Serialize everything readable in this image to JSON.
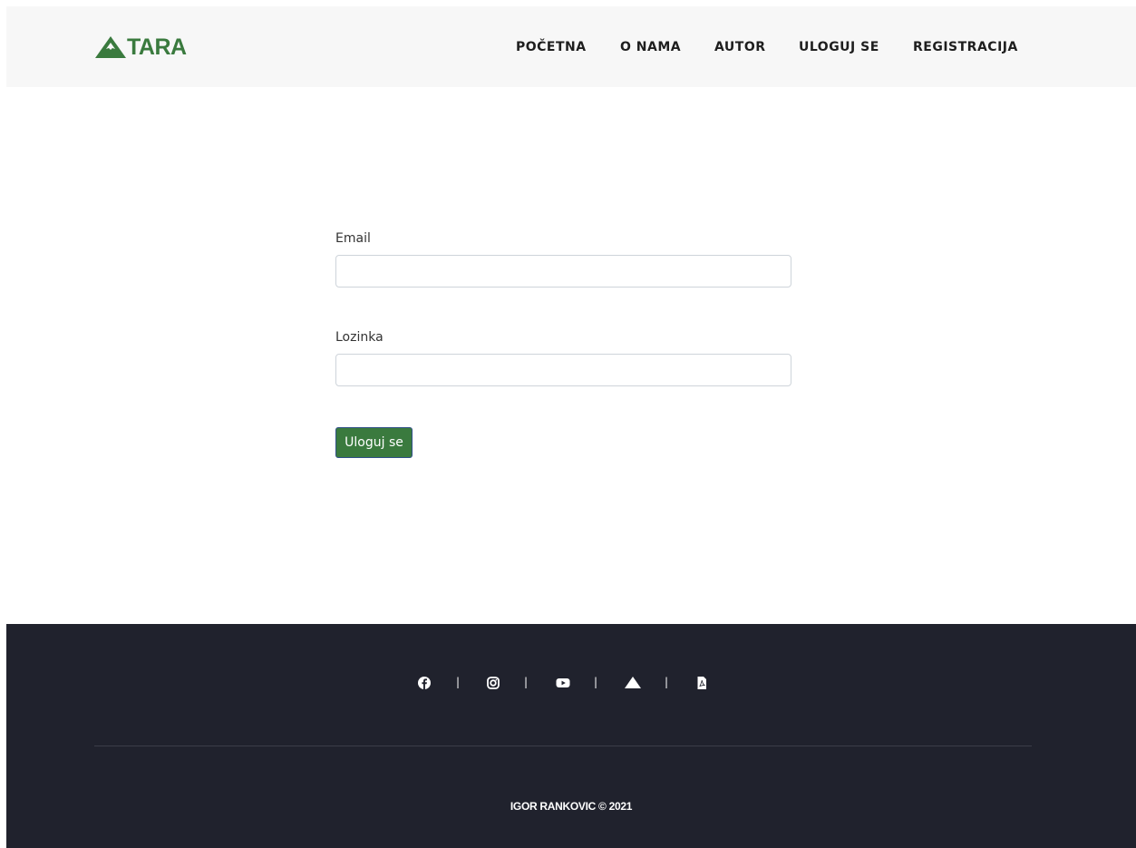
{
  "header": {
    "logo_text": "TARA",
    "brand_color": "#3a7a3e",
    "nav": [
      {
        "label": "POČETNA"
      },
      {
        "label": "O NAMA"
      },
      {
        "label": "AUTOR"
      },
      {
        "label": "ULOGUJ SE"
      },
      {
        "label": "REGISTRACIJA"
      }
    ]
  },
  "form": {
    "email_label": "Email",
    "email_value": "",
    "email_placeholder": "",
    "password_label": "Lozinka",
    "password_value": "",
    "password_placeholder": "",
    "submit_label": "Uloguj se"
  },
  "footer": {
    "background": "#20222d",
    "social_icons": [
      "facebook-icon",
      "instagram-icon",
      "youtube-icon",
      "mountain-icon",
      "pdf-icon"
    ],
    "separator": "|",
    "copyright": "IGOR RANKOVIC © 2021"
  }
}
